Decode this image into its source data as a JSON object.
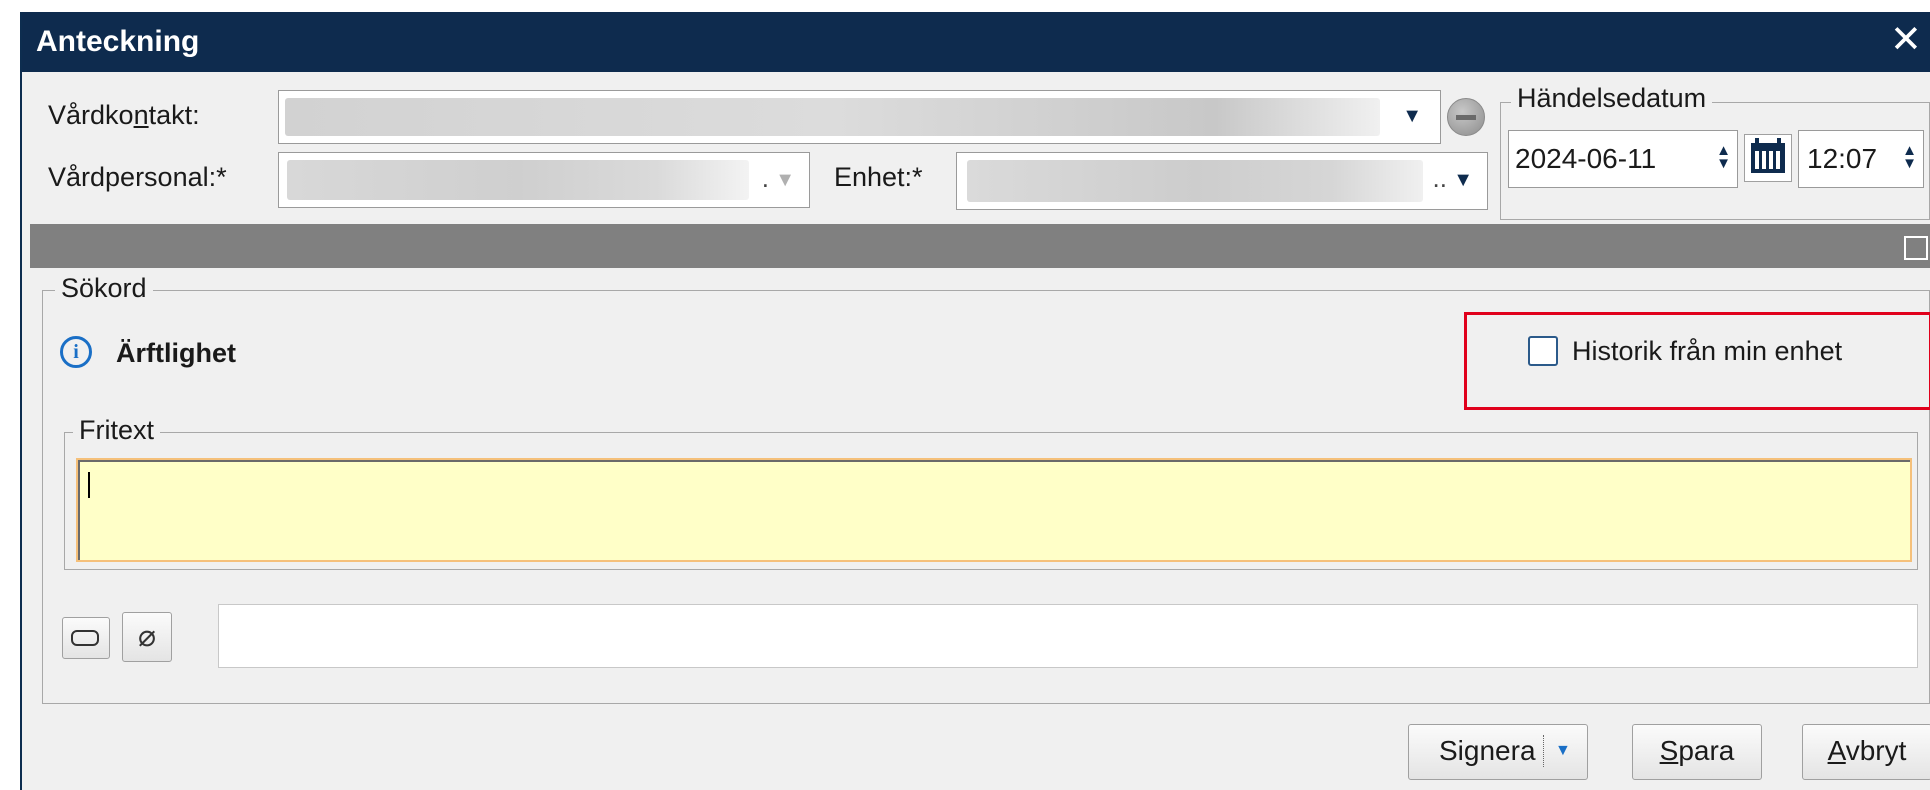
{
  "window": {
    "title": "Anteckning",
    "close_icon": "close-icon"
  },
  "header": {
    "vardkontakt_label": "Vårdko",
    "vardkontakt_label_underline": "n",
    "vardkontakt_label_rest": "takt:",
    "vardpersonal_label": "Vårdpersonal:*",
    "vardpersonal_suffix": ".",
    "enhet_label": "Enhet:*",
    "enhet_suffix": "..",
    "handelsedatum_legend": "Händelsedatum",
    "date_value": "2024-06-11",
    "time_value": "12:07"
  },
  "panel": {
    "sokord_legend": "Sökord",
    "keyword": "Ärftlighet",
    "history_checkbox_label": "Historik från min enhet",
    "history_checked": false,
    "highlight_color": "#e0001b",
    "fritext_legend": "Fritext",
    "fritext_value": "",
    "fritext_bg": "#ffffc8"
  },
  "footer": {
    "signera_prefix": "Si",
    "signera_underline": "g",
    "signera_rest": "nera",
    "spara_underline": "S",
    "spara_rest": "para",
    "avbryt_underline": "A",
    "avbryt_rest": "vbryt"
  },
  "colors": {
    "titlebar": "#0e2b4e",
    "separator_bar": "#808080",
    "accent": "#0e2b4e"
  }
}
